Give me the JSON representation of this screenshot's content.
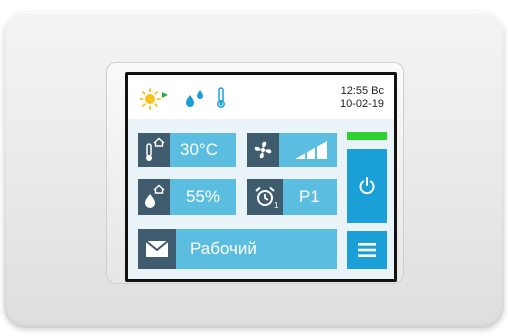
{
  "status_bar": {
    "time": "12:55 Вс",
    "date": "10-02-19",
    "icons": [
      "sun-play-icon",
      "water-drops-icon",
      "thermometer-icon"
    ]
  },
  "tiles": {
    "temperature": {
      "value": "30°C",
      "icon": "home-thermometer-icon"
    },
    "fan": {
      "icon": "fan-icon",
      "level": "fan-speed-bars-icon"
    },
    "humidity": {
      "value": "55%",
      "icon": "home-droplet-icon"
    },
    "schedule": {
      "value": "P1",
      "icon": "alarm-clock-icon",
      "subscript": "1"
    },
    "mode": {
      "value": "Рабочий",
      "icon": "envelope-icon"
    }
  },
  "buttons": {
    "power": {
      "icon": "power-icon"
    },
    "menu": {
      "icon": "menu-icon"
    }
  },
  "colors": {
    "tile_light": "#5bbde0",
    "tile_icon_bg": "#3f5c6e",
    "button_blue": "#1a9fd7",
    "indicator_green": "#2ed22e"
  }
}
